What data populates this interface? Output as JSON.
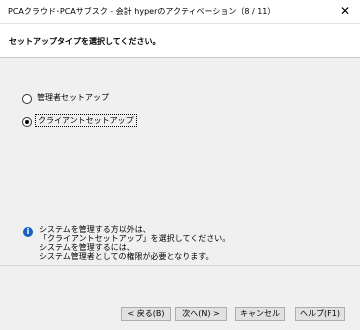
{
  "window": {
    "title": "PCAクラウド･PCAサブスク - 会計 hyperのアクティベーション（8 / 11）",
    "close_glyph": "✕"
  },
  "header": {
    "heading": "セットアップタイプを選択してください。"
  },
  "options": [
    {
      "label": "管理者セットアップ",
      "selected": false
    },
    {
      "label": "クライアントセットアップ",
      "selected": true
    }
  ],
  "info": {
    "icon": "info-icon",
    "lines": [
      "システムを管理する方以外は、",
      "「クライアントセットアップ」を選択してください。",
      "システムを管理するには、",
      "システム管理者としての権限が必要となります。"
    ]
  },
  "buttons": {
    "back": "< 戻る(B)",
    "next": "次へ(N) >",
    "cancel": "キャンセル",
    "help": "ヘルプ(F1)"
  },
  "colors": {
    "info_icon": "#1a5fc4",
    "background": "#f0f0f0"
  }
}
